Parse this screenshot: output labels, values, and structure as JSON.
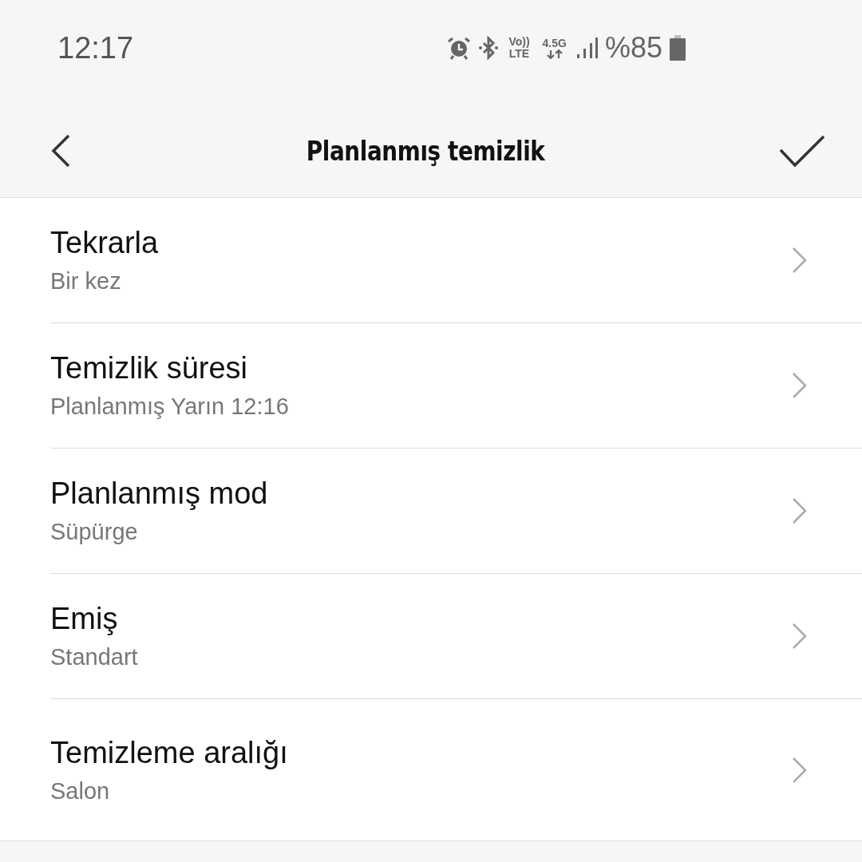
{
  "status_bar": {
    "time": "12:17",
    "volte_top": "Vo))",
    "volte_bottom": "LTE",
    "network": "4.5G",
    "battery": "%85"
  },
  "header": {
    "title": "Planlanmış temizlik"
  },
  "items": [
    {
      "title": "Tekrarla",
      "value": "Bir kez"
    },
    {
      "title": "Temizlik süresi",
      "value": "Planlanmış Yarın 12:16"
    },
    {
      "title": "Planlanmış mod",
      "value": "Süpürge"
    },
    {
      "title": "Emiş",
      "value": "Standart"
    },
    {
      "title": "Temizleme aralığı",
      "value": "Salon"
    }
  ]
}
